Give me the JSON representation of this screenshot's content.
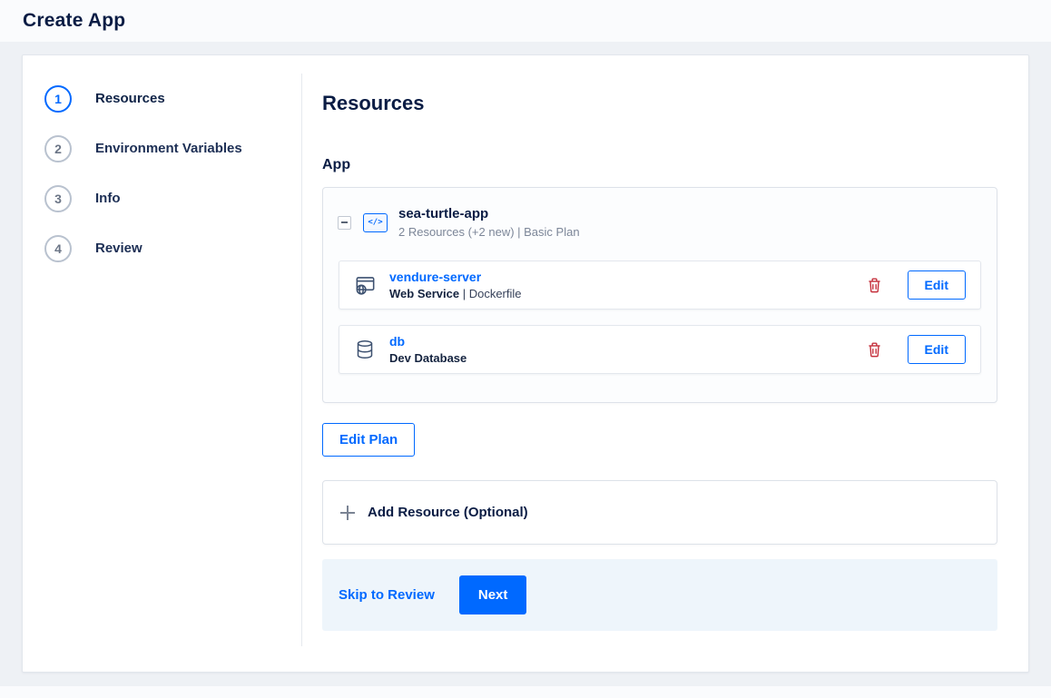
{
  "page": {
    "title": "Create App"
  },
  "stepper": {
    "steps": [
      {
        "number": "1",
        "label": "Resources",
        "active": true
      },
      {
        "number": "2",
        "label": "Environment Variables",
        "active": false
      },
      {
        "number": "3",
        "label": "Info",
        "active": false
      },
      {
        "number": "4",
        "label": "Review",
        "active": false
      }
    ]
  },
  "content": {
    "heading": "Resources",
    "section_label": "App",
    "app": {
      "code_icon_glyph": "</>",
      "name": "sea-turtle-app",
      "subtitle": "2 Resources (+2 new) | Basic Plan",
      "resources": [
        {
          "name": "vendure-server",
          "type": "Web Service",
          "detail": " | Dockerfile",
          "icon": "web-service-icon"
        },
        {
          "name": "db",
          "type": "Dev Database",
          "detail": "",
          "icon": "database-icon"
        }
      ]
    },
    "buttons": {
      "edit": "Edit",
      "edit_plan": "Edit Plan",
      "skip": "Skip to Review",
      "next": "Next"
    },
    "add_resource_label": "Add Resource (Optional)"
  },
  "colors": {
    "accent": "#0069ff",
    "danger": "#c5303c",
    "heading": "#0a1c44",
    "footer_bg": "#eef5fb"
  }
}
